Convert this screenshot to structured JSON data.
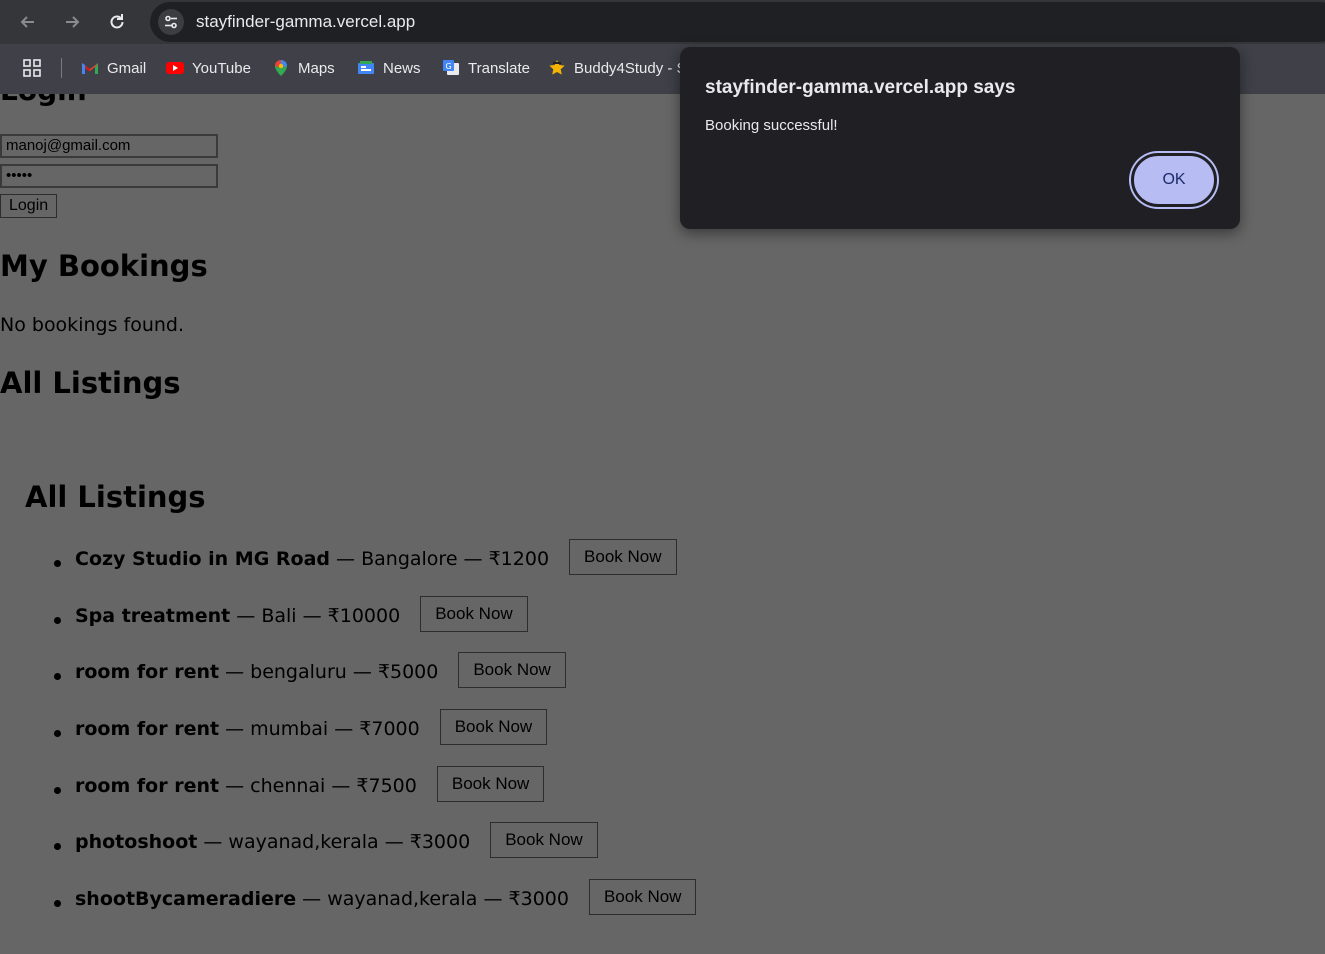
{
  "browser": {
    "url": "stayfinder-gamma.vercel.app",
    "bookmarks": [
      {
        "label": "Gmail",
        "icon": "gmail-icon"
      },
      {
        "label": "YouTube",
        "icon": "youtube-icon"
      },
      {
        "label": "Maps",
        "icon": "maps-icon"
      },
      {
        "label": "News",
        "icon": "news-icon"
      },
      {
        "label": "Translate",
        "icon": "translate-icon"
      },
      {
        "label": "Buddy4Study - S",
        "icon": "buddy4study-icon"
      }
    ]
  },
  "login": {
    "heading": "Login",
    "email_value": "manoj@gmail.com",
    "password_value": "•••••",
    "button_label": "Login"
  },
  "my_bookings": {
    "heading": "My Bookings",
    "empty_text": "No bookings found."
  },
  "all_listings_heading": "All Listings",
  "listings_section": {
    "heading": "All Listings",
    "book_label": "Book Now",
    "items": [
      {
        "title": "Cozy Studio in MG Road",
        "detail": " — Bangalore — ₹1200"
      },
      {
        "title": "Spa treatment",
        "detail": " — Bali — ₹10000"
      },
      {
        "title": "room for rent",
        "detail": " — bengaluru — ₹5000"
      },
      {
        "title": "room for rent",
        "detail": " — mumbai — ₹7000"
      },
      {
        "title": "room for rent",
        "detail": " — chennai — ₹7500"
      },
      {
        "title": "photoshoot",
        "detail": " — wayanad,kerala — ₹3000"
      },
      {
        "title": "shootBycameradiere",
        "detail": " — wayanad,kerala — ₹3000"
      }
    ]
  },
  "alert": {
    "title": "stayfinder-gamma.vercel.app says",
    "message": "Booking successful!",
    "ok_label": "OK"
  },
  "colors": {
    "overlay_background": "#666666",
    "dialog_background": "#1f1f24",
    "ok_button": "#b7bcf3"
  }
}
